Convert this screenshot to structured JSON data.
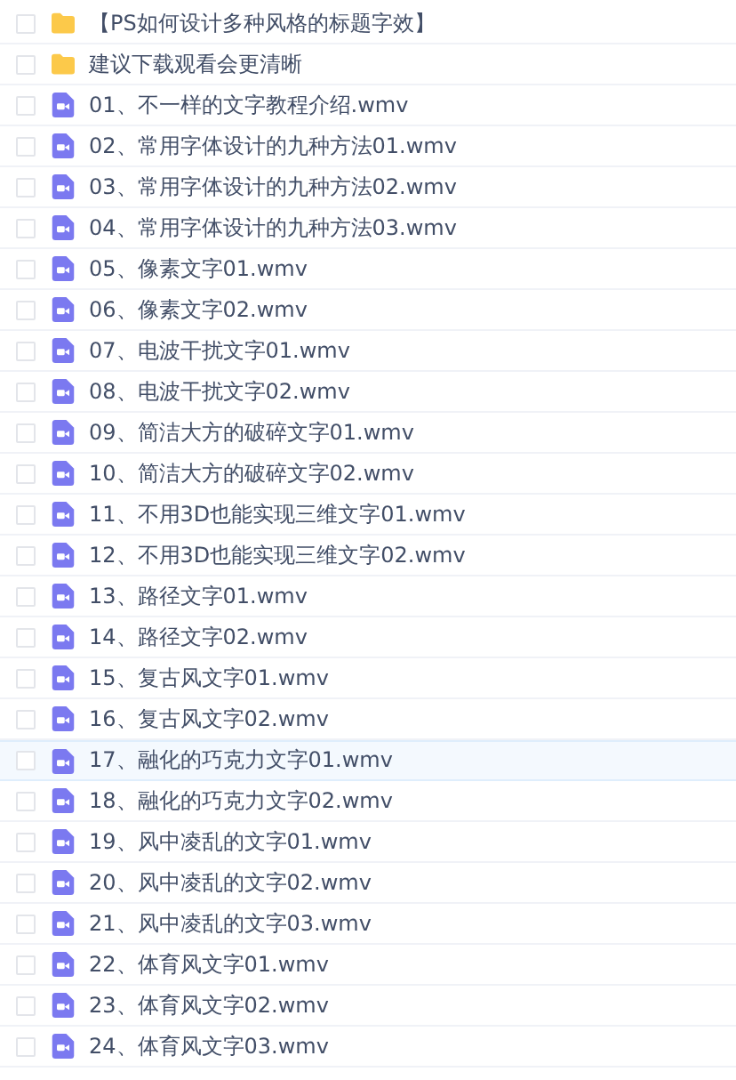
{
  "files": [
    {
      "kind": "folder",
      "name": "【PS如何设计多种风格的标题字效】",
      "checked": false,
      "selected": false
    },
    {
      "kind": "folder",
      "name": "建议下载观看会更清晰",
      "checked": false,
      "selected": false
    },
    {
      "kind": "video",
      "name": "01、不一样的文字教程介绍.wmv",
      "checked": false,
      "selected": false
    },
    {
      "kind": "video",
      "name": "02、常用字体设计的九种方法01.wmv",
      "checked": false,
      "selected": false
    },
    {
      "kind": "video",
      "name": "03、常用字体设计的九种方法02.wmv",
      "checked": false,
      "selected": false
    },
    {
      "kind": "video",
      "name": "04、常用字体设计的九种方法03.wmv",
      "checked": false,
      "selected": false
    },
    {
      "kind": "video",
      "name": "05、像素文字01.wmv",
      "checked": false,
      "selected": false
    },
    {
      "kind": "video",
      "name": "06、像素文字02.wmv",
      "checked": false,
      "selected": false
    },
    {
      "kind": "video",
      "name": "07、电波干扰文字01.wmv",
      "checked": false,
      "selected": false
    },
    {
      "kind": "video",
      "name": "08、电波干扰文字02.wmv",
      "checked": false,
      "selected": false
    },
    {
      "kind": "video",
      "name": "09、简洁大方的破碎文字01.wmv",
      "checked": false,
      "selected": false
    },
    {
      "kind": "video",
      "name": "10、简洁大方的破碎文字02.wmv",
      "checked": false,
      "selected": false
    },
    {
      "kind": "video",
      "name": "11、不用3D也能实现三维文字01.wmv",
      "checked": false,
      "selected": false
    },
    {
      "kind": "video",
      "name": "12、不用3D也能实现三维文字02.wmv",
      "checked": false,
      "selected": false
    },
    {
      "kind": "video",
      "name": "13、路径文字01.wmv",
      "checked": false,
      "selected": false
    },
    {
      "kind": "video",
      "name": "14、路径文字02.wmv",
      "checked": false,
      "selected": false
    },
    {
      "kind": "video",
      "name": "15、复古风文字01.wmv",
      "checked": false,
      "selected": false
    },
    {
      "kind": "video",
      "name": "16、复古风文字02.wmv",
      "checked": false,
      "selected": false
    },
    {
      "kind": "video",
      "name": "17、融化的巧克力文字01.wmv",
      "checked": false,
      "selected": true
    },
    {
      "kind": "video",
      "name": "18、融化的巧克力文字02.wmv",
      "checked": false,
      "selected": false
    },
    {
      "kind": "video",
      "name": "19、风中凌乱的文字01.wmv",
      "checked": false,
      "selected": false
    },
    {
      "kind": "video",
      "name": "20、风中凌乱的文字02.wmv",
      "checked": false,
      "selected": false
    },
    {
      "kind": "video",
      "name": "21、风中凌乱的文字03.wmv",
      "checked": false,
      "selected": false
    },
    {
      "kind": "video",
      "name": "22、体育风文字01.wmv",
      "checked": false,
      "selected": false
    },
    {
      "kind": "video",
      "name": "23、体育风文字02.wmv",
      "checked": false,
      "selected": false
    },
    {
      "kind": "video",
      "name": "24、体育风文字03.wmv",
      "checked": false,
      "selected": false
    }
  ]
}
